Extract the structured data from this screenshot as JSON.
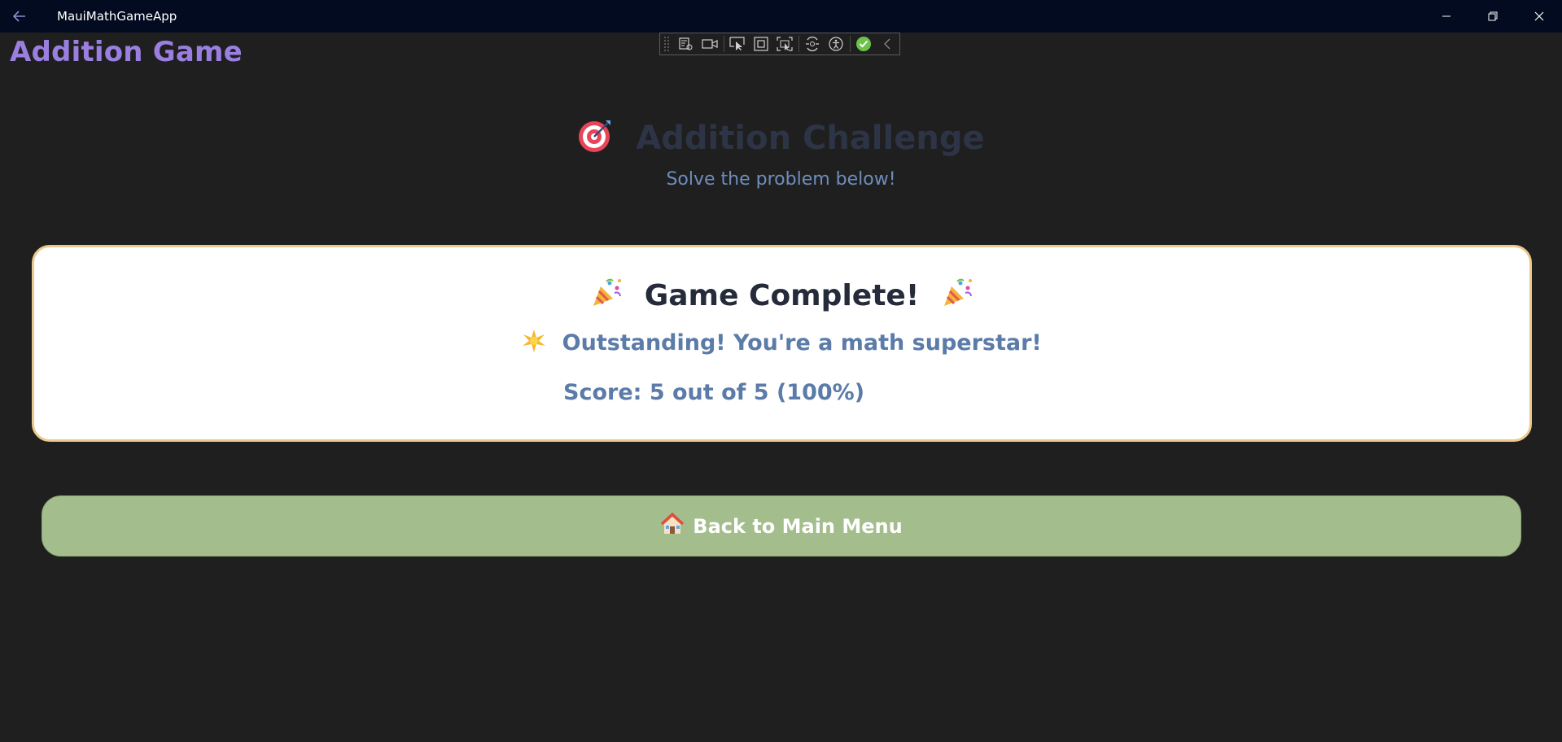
{
  "window": {
    "title": "MauiMathGameApp",
    "back_icon": "back-arrow-icon",
    "controls": [
      "minimize-icon",
      "restore-icon",
      "close-icon"
    ]
  },
  "page": {
    "heading": "Addition Game",
    "heading_color": "#9b7fe0"
  },
  "dev_toolbar": {
    "icons": [
      "live-visual-tree-icon",
      "video-icon",
      "select-element-icon",
      "display-layout-adorners-icon",
      "track-focus-icon",
      "hot-reload-icon",
      "accessibility-icon",
      "binding-check-icon",
      "collapse-icon"
    ]
  },
  "challenge": {
    "icon": "target-icon",
    "title": "Addition Challenge",
    "subtitle": "Solve the problem below!"
  },
  "result": {
    "title_icon": "party-popper-icon",
    "title": "Game Complete!",
    "message_icon": "sparkle-star-icon",
    "message": "Outstanding! You're a math superstar!",
    "score": "Score: 5 out of 5 (100%)",
    "border_color": "#ecc98a"
  },
  "actions": {
    "back_icon": "house-icon",
    "back_label": "Back to Main Menu",
    "back_color": "#a3bd8c"
  }
}
